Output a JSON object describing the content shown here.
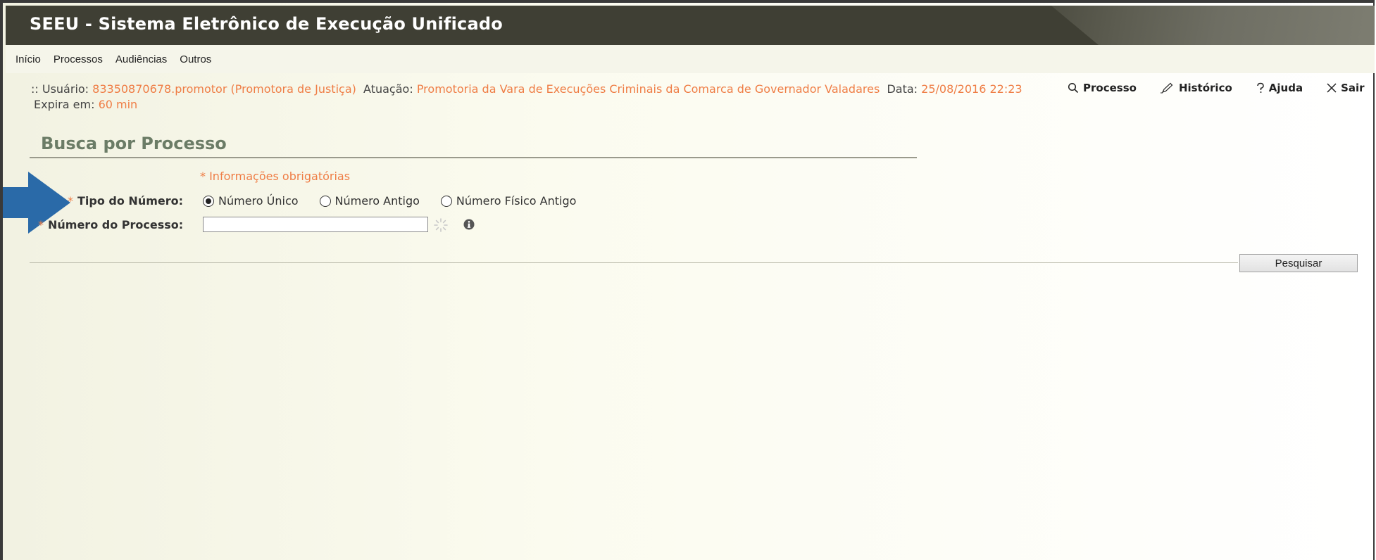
{
  "app": {
    "title": "SEEU - Sistema Eletrônico de Execução Unificado"
  },
  "menu": {
    "items": [
      "Início",
      "Processos",
      "Audiências",
      "Outros"
    ]
  },
  "user_info": {
    "prefix": ":: Usuário:",
    "user": "83350870678.promotor (Promotora de Justiça)",
    "atuacao_label": "Atuação:",
    "atuacao": "Promotoria da Vara de Execuções Criminais da Comarca de Governador Valadares",
    "data_label": "Data:",
    "data": "25/08/2016 22:23",
    "expira_label": "Expira em:",
    "expira": "60 min"
  },
  "top_links": {
    "processo": "Processo",
    "historico": "Histórico",
    "ajuda": "Ajuda",
    "sair": "Sair"
  },
  "form": {
    "section_title": "Busca por Processo",
    "required_note": "* Informações obrigatórias",
    "asterisk": "*",
    "tipo_label": "Tipo do Número:",
    "tipo_options": [
      {
        "label": "Número Único",
        "selected": true
      },
      {
        "label": "Número Antigo",
        "selected": false
      },
      {
        "label": "Número Físico Antigo",
        "selected": false
      }
    ],
    "numero_label": "Número do Processo:",
    "numero_value": "",
    "search_label": "Pesquisar"
  },
  "colors": {
    "header_bg": "#3f3f34",
    "accent_orange": "#ef7d45",
    "section_title": "#6b7c66",
    "arrow_blue": "#2a6aa8"
  },
  "icons": [
    "search-icon",
    "pencil-icon",
    "question-icon",
    "close-icon",
    "loading-spinner-icon",
    "info-icon",
    "arrow-pointer-icon"
  ]
}
